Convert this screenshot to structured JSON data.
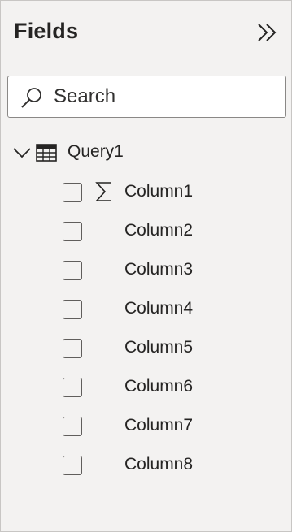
{
  "pane": {
    "title": "Fields",
    "collapse_icon": "double-chevron-right-icon"
  },
  "search": {
    "placeholder": "Search",
    "value": "",
    "icon": "search-icon"
  },
  "tree": {
    "table": {
      "label": "Query1",
      "expanded": true,
      "icon": "table-icon",
      "fields": [
        {
          "label": "Column1",
          "checked": false,
          "sigma": true
        },
        {
          "label": "Column2",
          "checked": false,
          "sigma": false
        },
        {
          "label": "Column3",
          "checked": false,
          "sigma": false
        },
        {
          "label": "Column4",
          "checked": false,
          "sigma": false
        },
        {
          "label": "Column5",
          "checked": false,
          "sigma": false
        },
        {
          "label": "Column6",
          "checked": false,
          "sigma": false
        },
        {
          "label": "Column7",
          "checked": false,
          "sigma": false
        },
        {
          "label": "Column8",
          "checked": false,
          "sigma": false
        }
      ]
    }
  },
  "colors": {
    "pane_bg": "#f3f2f1",
    "text": "#252423",
    "border": "#8a8886"
  }
}
